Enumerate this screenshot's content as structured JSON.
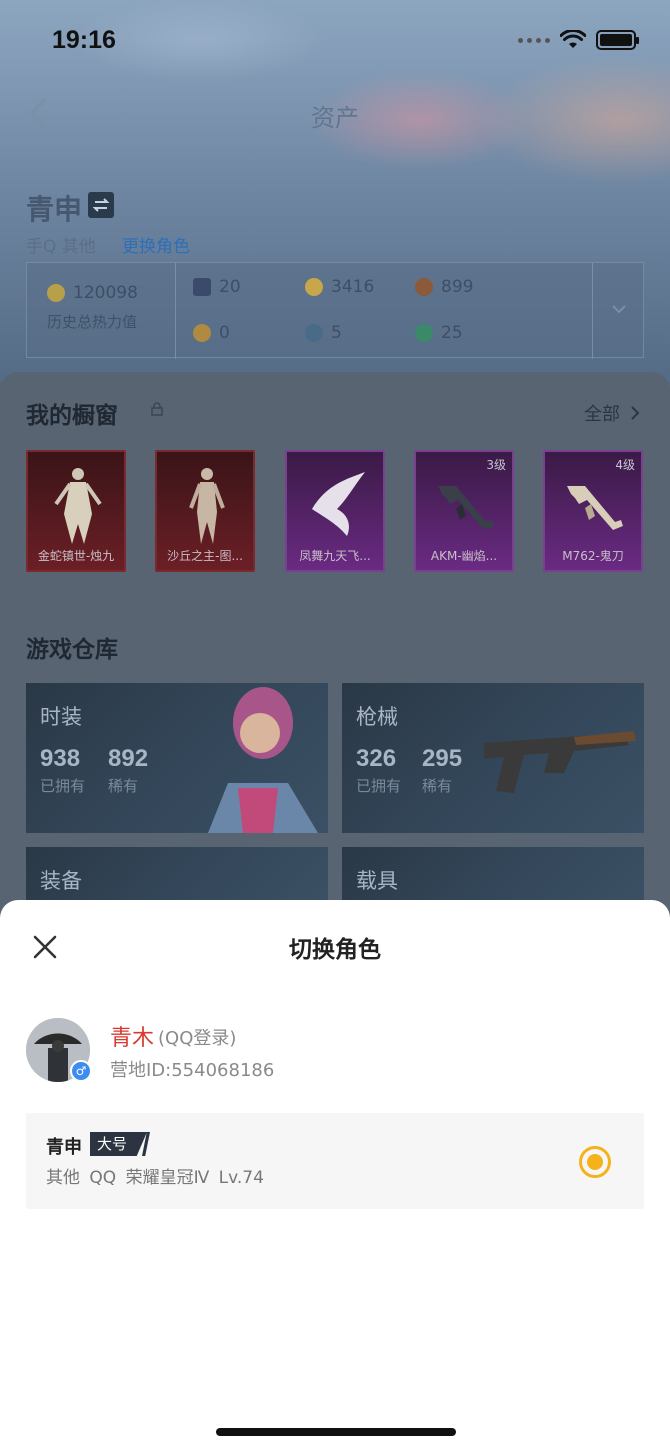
{
  "status_bar": {
    "time": "19:16"
  },
  "header": {
    "title": "资产"
  },
  "player": {
    "name": "青申",
    "platform": "手Q 其他",
    "link_text": "更换角色"
  },
  "stats": {
    "total_heat": "120098",
    "total_heat_label": "历史总热力值",
    "cells": [
      "20",
      "3416",
      "899",
      "0",
      "5",
      "25"
    ],
    "coin_colors": [
      "#3b4a6a",
      "#c8a64a",
      "#8a5a3a",
      "#b08a40",
      "#4a6a8a",
      "#3a8a6a"
    ]
  },
  "showcase": {
    "title": "我的橱窗",
    "see_all": "全部",
    "items": [
      {
        "name": "金蛇镇世-烛九",
        "level": "",
        "rarity": "red"
      },
      {
        "name": "沙丘之主-图...",
        "level": "",
        "rarity": "red"
      },
      {
        "name": "凤舞九天飞...",
        "level": "",
        "rarity": "purple"
      },
      {
        "name": "AKM-幽焰...",
        "level": "3级",
        "rarity": "purple"
      },
      {
        "name": "M762-鬼刀",
        "level": "4级",
        "rarity": "purple"
      }
    ]
  },
  "warehouse": {
    "title": "游戏仓库",
    "owned_label": "已拥有",
    "rare_label": "稀有",
    "cards": [
      {
        "title": "时装",
        "owned": "938",
        "rare": "892"
      },
      {
        "title": "枪械",
        "owned": "326",
        "rare": "295"
      },
      {
        "title": "装备"
      },
      {
        "title": "载具"
      }
    ]
  },
  "sheet": {
    "title": "切换角色",
    "account": {
      "name": "青木",
      "login": "(QQ登录)",
      "id_text": "营地ID:554068186",
      "gender": "♂"
    },
    "role": {
      "name": "青申",
      "tag": "大号",
      "info": "其他 QQ   荣耀皇冠Ⅳ   Lv.74",
      "selected": true,
      "accent": "#f5b21b"
    }
  }
}
